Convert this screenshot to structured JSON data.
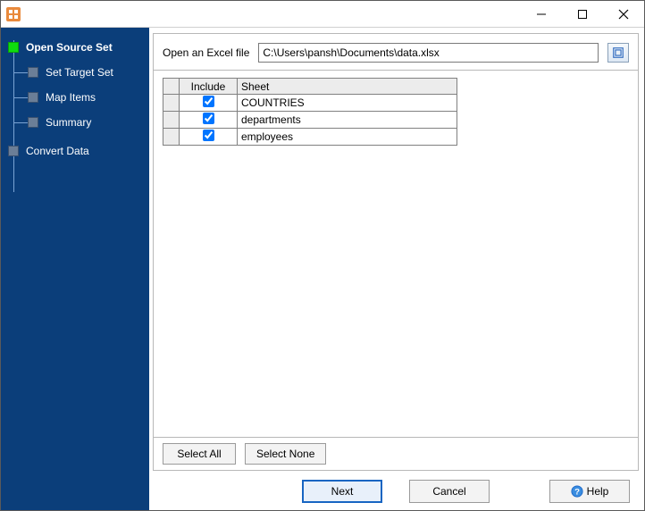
{
  "window": {
    "title": ""
  },
  "nav": {
    "items": [
      {
        "label": "Open Source Set",
        "active": true,
        "indent": 0
      },
      {
        "label": "Set Target Set",
        "active": false,
        "indent": 1
      },
      {
        "label": "Map Items",
        "active": false,
        "indent": 1
      },
      {
        "label": "Summary",
        "active": false,
        "indent": 1
      },
      {
        "label": "Convert Data",
        "active": false,
        "indent": 0
      }
    ]
  },
  "panel": {
    "open_label": "Open an Excel file",
    "path_value": "C:\\Users\\pansh\\Documents\\data.xlsx",
    "columns": {
      "include": "Include",
      "sheet": "Sheet"
    },
    "rows": [
      {
        "include": true,
        "sheet": "COUNTRIES"
      },
      {
        "include": true,
        "sheet": "departments"
      },
      {
        "include": true,
        "sheet": "employees"
      }
    ],
    "select_all": "Select All",
    "select_none": "Select None"
  },
  "footer": {
    "next": "Next",
    "cancel": "Cancel",
    "help": "Help"
  }
}
